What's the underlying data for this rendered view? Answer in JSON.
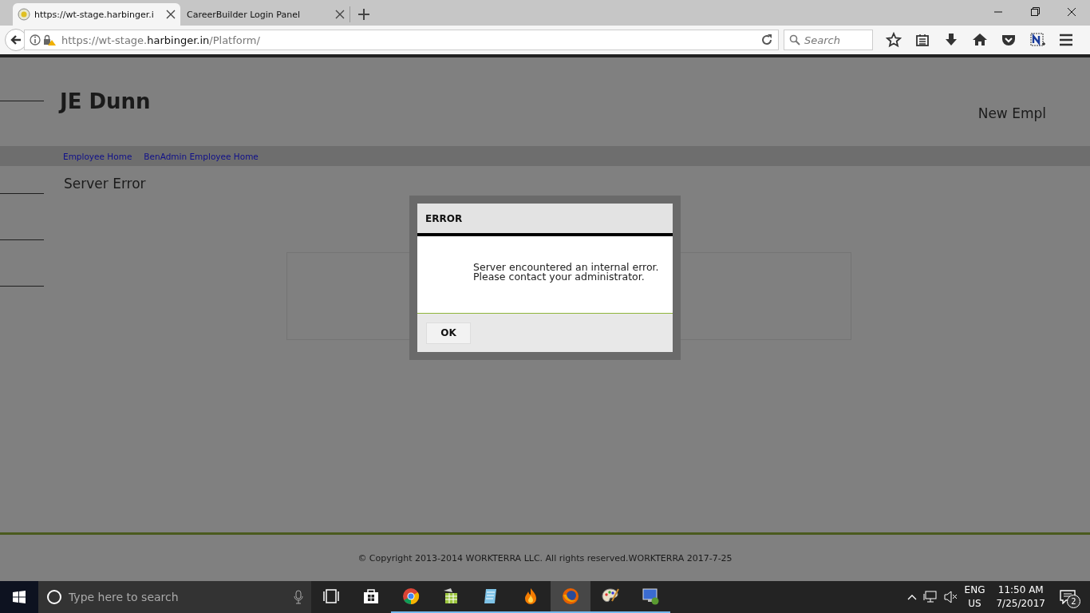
{
  "browser": {
    "tabs": [
      {
        "title": "https://wt-stage.harbinger.i",
        "selected": true
      },
      {
        "title": "CareerBuilder Login Panel",
        "selected": false
      }
    ],
    "url": {
      "prefix": "https://wt-stage.",
      "domain": "harbinger.in",
      "path": "/Platform/"
    },
    "search": {
      "placeholder": "Search"
    }
  },
  "page": {
    "company": "JE Dunn",
    "header_right": "New Empl",
    "nav_links": [
      "Employee Home",
      "BenAdmin Employee Home"
    ],
    "heading": "Server Error",
    "footer": "© Copyright 2013-2014 WORKTERRA LLC. All rights reserved.WORKTERRA 2017-7-25"
  },
  "dialog": {
    "title": "ERROR",
    "message_lines": [
      "Server encountered an internal error.",
      "Please contact your administrator."
    ],
    "button": "OK"
  },
  "taskbar": {
    "search_placeholder": "Type here to search",
    "apps": [
      {
        "kind": "taskview",
        "running": false,
        "selected": false
      },
      {
        "kind": "store",
        "running": false,
        "selected": false
      },
      {
        "kind": "chrome",
        "running": true,
        "selected": false
      },
      {
        "kind": "sheet",
        "running": true,
        "selected": false
      },
      {
        "kind": "notepad",
        "running": true,
        "selected": false
      },
      {
        "kind": "flame",
        "running": true,
        "selected": false
      },
      {
        "kind": "firefox",
        "running": true,
        "selected": true
      },
      {
        "kind": "paint",
        "running": true,
        "selected": false
      },
      {
        "kind": "remote",
        "running": true,
        "selected": false
      }
    ],
    "language": [
      "ENG",
      "US"
    ],
    "time": "11:50 AM",
    "date": "7/25/2017",
    "notifications": "2"
  }
}
